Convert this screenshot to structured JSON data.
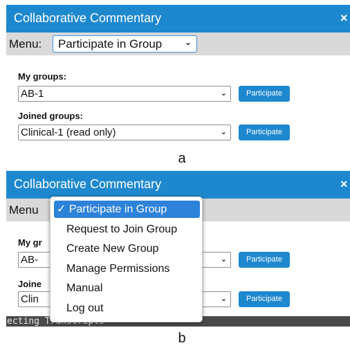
{
  "panel_a": {
    "title": "Collaborative Commentary",
    "close": "×",
    "menu_label": "Menu:",
    "menu_value": "Participate in Group",
    "my_groups_label": "My groups:",
    "my_groups_value": "AB-1",
    "joined_groups_label": "Joined groups:",
    "joined_groups_value": "Clinical-1 (read only)",
    "participate_label": "Participate",
    "caption": "a"
  },
  "panel_b": {
    "title": "Collaborative Commentary",
    "close": "×",
    "menu_label_partial": "Menu",
    "my_groups_partial": "My gr",
    "my_groups_value_partial": "AB-",
    "joined_partial": "Joine",
    "joined_value_partial": "Clin",
    "participate_label": "Participate",
    "background_text": "ecting Transcripts",
    "dropdown_items": [
      {
        "label": "✓ Participate in Group",
        "selected": true
      },
      {
        "label": "Request to Join Group",
        "selected": false
      },
      {
        "label": "Create New Group",
        "selected": false
      },
      {
        "label": "Manage Permissions",
        "selected": false
      },
      {
        "label": "Manual",
        "selected": false
      },
      {
        "label": "Log out",
        "selected": false
      }
    ],
    "caption": "b"
  },
  "colors": {
    "accent": "#1e88cf",
    "menubar": "#d9d9d9",
    "selected_item": "#2d82d9"
  }
}
